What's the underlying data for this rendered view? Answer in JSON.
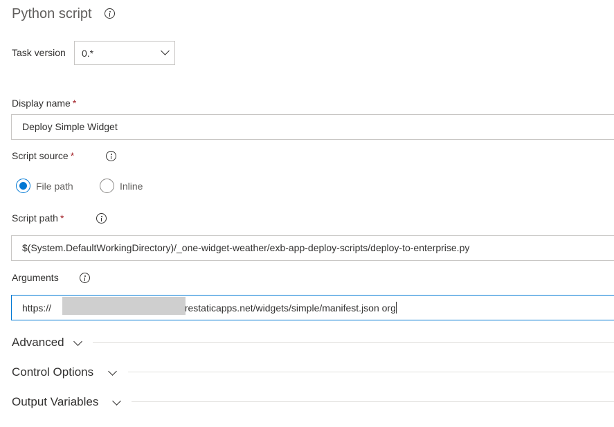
{
  "header": {
    "title": "Python script"
  },
  "task_version": {
    "label": "Task version",
    "value": "0.*"
  },
  "display_name": {
    "label": "Display name",
    "required_mark": "*",
    "value": "Deploy Simple Widget"
  },
  "script_source": {
    "label": "Script source",
    "required_mark": "*",
    "options": [
      {
        "label": "File path",
        "selected": true
      },
      {
        "label": "Inline",
        "selected": false
      }
    ]
  },
  "script_path": {
    "label": "Script path",
    "required_mark": "*",
    "value": "$(System.DefaultWorkingDirectory)/_one-widget-weather/exb-app-deploy-scripts/deploy-to-enterprise.py"
  },
  "arguments": {
    "label": "Arguments",
    "value_prefix": "https://",
    "value_suffix": "zurestaticapps.net/widgets/simple/manifest.json org"
  },
  "sections": [
    {
      "label": "Advanced"
    },
    {
      "label": "Control Options"
    },
    {
      "label": "Output Variables"
    }
  ],
  "colors": {
    "accent": "#0078d4",
    "required": "#a4262c",
    "border": "#c8c6c4",
    "text": "#323130"
  }
}
